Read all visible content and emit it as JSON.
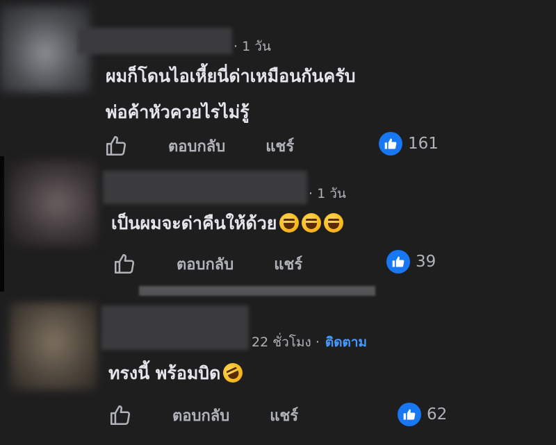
{
  "comments": [
    {
      "time": "· 1 วัน",
      "follow": "",
      "lines": [
        "ผมก็โดนไอเหี้ยนี่ด่าเหมือนกันครับ",
        "พ่อค้าหัวควยไรไม่รู้"
      ],
      "reply_label": "ตอบกลับ",
      "share_label": "แชร์",
      "likes": "161"
    },
    {
      "time": "· 1 วัน",
      "follow": "",
      "lines": [
        "เป็นผมจะด่าคืนให้ด้วย"
      ],
      "reply_label": "ตอบกลับ",
      "share_label": "แชร์",
      "likes": "39"
    },
    {
      "time": "22 ชั่วโมง ·",
      "follow": "ติดตาม",
      "lines": [
        "ทรงนี้ พร้อมบิด"
      ],
      "reply_label": "ตอบกลับ",
      "share_label": "แชร์",
      "likes": "62"
    }
  ],
  "icons": {
    "like_outline": "thumbs-up-outline-icon",
    "like_badge": "thumbs-up-filled-icon",
    "emoji_laugh": "grinning-squinting-face-icon",
    "emoji_rofl": "rolling-on-floor-laughing-icon"
  },
  "colors": {
    "background": "#1e1e1f",
    "text": "#e4e6eb",
    "secondary": "#b0b3b8",
    "accent": "#4599ff",
    "like_blue": "#1877f2"
  }
}
